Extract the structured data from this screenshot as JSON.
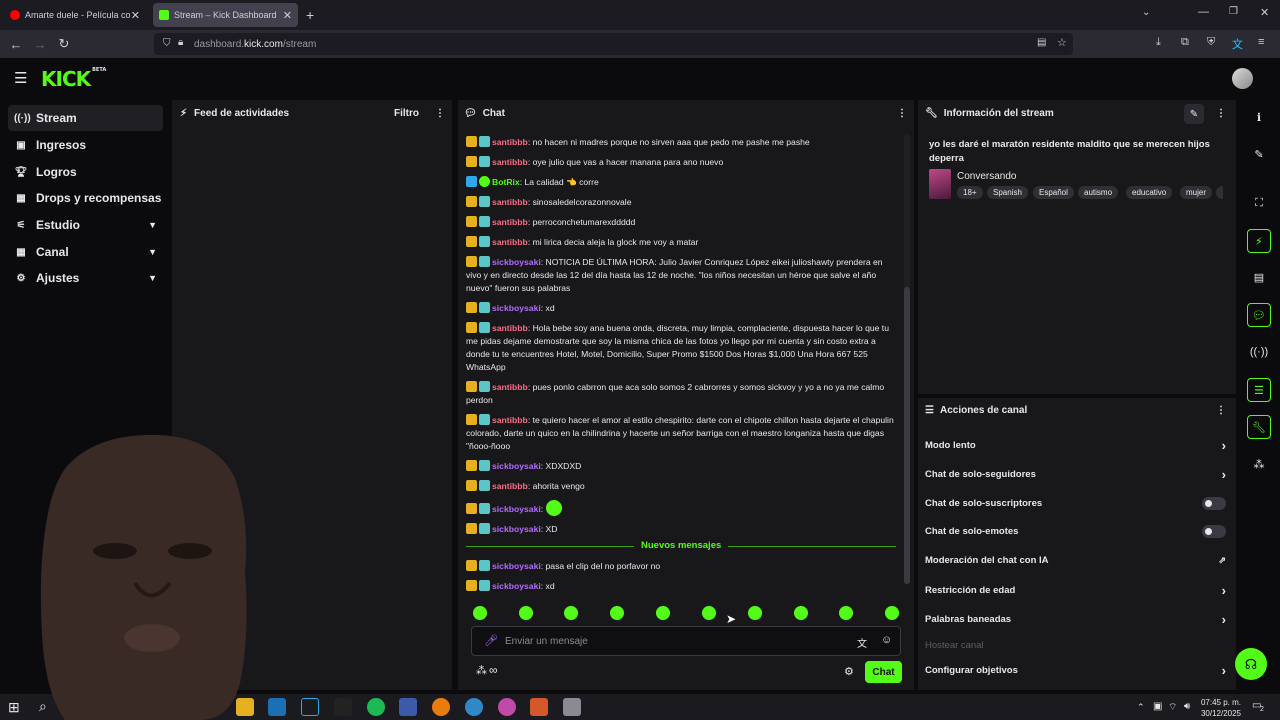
{
  "browser": {
    "tabs": [
      {
        "title": "Amarte duele - Película comple",
        "active": false
      },
      {
        "title": "Stream – Kick Dashboard",
        "active": true
      }
    ],
    "new_tab": "+",
    "url_domain_prefix": "dashboard.",
    "url_domain": "kick.com",
    "url_path": "/stream"
  },
  "brand": {
    "logo": "KICK",
    "badge": "BETA",
    "accent": "#53fc18"
  },
  "sidebar": {
    "items": [
      {
        "label": "Stream",
        "icon": "signal-icon"
      },
      {
        "label": "Ingresos",
        "icon": "wallet-icon"
      },
      {
        "label": "Logros",
        "icon": "trophy-icon"
      },
      {
        "label": "Drops y recompensas",
        "icon": "gift-icon"
      },
      {
        "label": "Estudio",
        "icon": "sliders-icon"
      },
      {
        "label": "Canal",
        "icon": "grid-icon"
      },
      {
        "label": "Ajustes",
        "icon": "gear-icon"
      }
    ]
  },
  "feed": {
    "title": "Feed de actividades",
    "filter": "Filtro"
  },
  "chat": {
    "title": "Chat",
    "messages": [
      {
        "user": "santibbb",
        "text": "no hacen ni madres porque no sirven aaa que pedo me pashe me pashe"
      },
      {
        "user": "santibbb",
        "text": "oye julio que vas a hacer manana para ano nuevo"
      },
      {
        "user": "BotRix",
        "text": "La calidad 👈 corre"
      },
      {
        "user": "santibbb",
        "text": "sinosaledelcorazonnovale"
      },
      {
        "user": "santibbb",
        "text": "perroconchetumarexddddd"
      },
      {
        "user": "santibbb",
        "text": "mi lirica decia aleja la glock me voy a matar"
      },
      {
        "user": "sickboysaki",
        "text": "NOTICIA DE ÚLTIMA HORA: Julio Javier Conriquez López eikei julioshawty prendera en vivo y en directo desde las 12 del día hasta las 12 de noche. \"los niños necesitan un héroe que salve el año nuevo\" fueron sus palabras"
      },
      {
        "user": "sickboysaki",
        "text": "xd"
      },
      {
        "user": "santibbb",
        "text": "Hola bebe soy ana buena onda, discreta, muy limpia, complaciente, dispuesta hacer lo que tu me pidas dejame demostrarte que soy la misma chica de las fotos yo llego por mi cuenta y sin costo extra a donde tu te encuentres Hotel, Motel, Domicilio, Super Promo $1500 Dos Horas $1,000 Una Hora 667 525 WhatsApp"
      },
      {
        "user": "santibbb",
        "text": "pues ponlo cabrron que aca solo somos 2 cabrorres y somos sickvoy y yo a no ya me calmo perdon"
      },
      {
        "user": "santibbb",
        "text": "te quiero hacer el amor al estilo chespirito: darte con el chipote chillon hasta dejarte el chapulin colorado, darte un quico en la chilindrina y hacerte un señor barriga con el maestro longaniza hasta que digas \"ñooo-ñooo"
      },
      {
        "user": "sickboysaki",
        "text": "XDXDXD"
      },
      {
        "user": "santibbb",
        "text": "ahorita vengo"
      },
      {
        "user": "sickboysaki",
        "text": ""
      },
      {
        "user": "sickboysaki",
        "text": "XD"
      }
    ],
    "new_messages_label": "Nuevos mensajes",
    "new_messages": [
      {
        "user": "sickboysaki",
        "text": "pasa el clip del no porfavor no"
      },
      {
        "user": "sickboysaki",
        "text": "xd"
      }
    ],
    "input_placeholder": "Enviar un mensaje",
    "infinity": "∞",
    "send_label": "Chat"
  },
  "stream_info": {
    "title": "Información del stream",
    "stream_title": "yo les daré el maratón residente maldito que se merecen hijos deperra",
    "category": "Conversando",
    "tags": [
      "18+",
      "Spanish",
      "Español",
      "autismo",
      "educativo",
      "mujer"
    ]
  },
  "channel_actions": {
    "title": "Acciones de canal",
    "rows": [
      {
        "label": "Modo lento",
        "control": "chevron"
      },
      {
        "label": "Chat de solo-seguidores",
        "control": "chevron"
      },
      {
        "label": "Chat de solo-suscriptores",
        "control": "toggle",
        "on": false
      },
      {
        "label": "Chat de solo-emotes",
        "control": "toggle",
        "on": false
      },
      {
        "label": "Moderación del chat con IA",
        "control": "external"
      },
      {
        "label": "Restricción de edad",
        "control": "chevron"
      },
      {
        "label": "Palabras baneadas",
        "control": "chevron"
      },
      {
        "label": "Hostear canal",
        "control": "none",
        "disabled": true
      },
      {
        "label": "Configurar objetivos",
        "control": "chevron"
      }
    ]
  },
  "taskbar": {
    "time": "07:45 p. m.",
    "date": "30/12/2025",
    "notifications": "2"
  }
}
